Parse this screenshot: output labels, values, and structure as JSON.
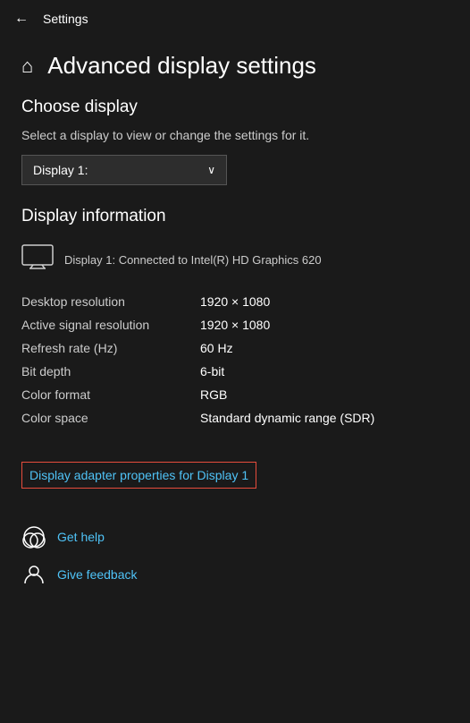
{
  "titlebar": {
    "back_label": "←",
    "title": "Settings"
  },
  "page_header": {
    "home_icon": "⌂",
    "title": "Advanced display settings"
  },
  "choose_display": {
    "section_title": "Choose display",
    "description": "Select a display to view or change the settings for it.",
    "dropdown_value": "Display 1:",
    "dropdown_arrow": "∨"
  },
  "display_information": {
    "section_title": "Display information",
    "monitor_icon": "🖥",
    "display_name": "Display 1: Connected to Intel(R) HD Graphics 620",
    "rows": [
      {
        "label": "Desktop resolution",
        "value": "1920 × 1080"
      },
      {
        "label": "Active signal resolution",
        "value": "1920 × 1080"
      },
      {
        "label": "Refresh rate (Hz)",
        "value": "60 Hz"
      },
      {
        "label": "Bit depth",
        "value": "6-bit"
      },
      {
        "label": "Color format",
        "value": "RGB"
      },
      {
        "label": "Color space",
        "value": "Standard dynamic range (SDR)"
      }
    ]
  },
  "adapter_link": {
    "label": "Display adapter properties for Display 1"
  },
  "footer": {
    "items": [
      {
        "icon": "💬",
        "label": "Get help"
      },
      {
        "icon": "👤",
        "label": "Give feedback"
      }
    ]
  }
}
